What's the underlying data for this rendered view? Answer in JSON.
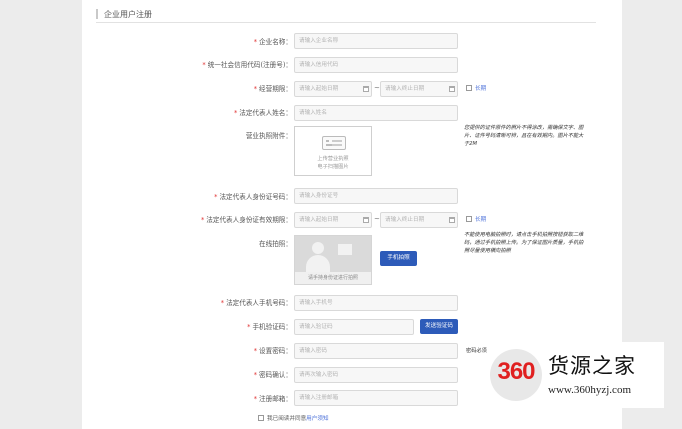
{
  "header": {
    "title": "企业用户注册"
  },
  "fields": {
    "company_name": {
      "label": "企业名称：",
      "placeholder": "请输入企业名称"
    },
    "credit_code": {
      "label": "统一社会信用代码(注册号)：",
      "placeholder": "请输入信用代码"
    },
    "business_period": {
      "label": "经营期限：",
      "start_placeholder": "请输入起始日期",
      "end_placeholder": "请输入终止日期",
      "dash": "~",
      "long_term": "长期"
    },
    "legal_rep_name": {
      "label": "法定代表人姓名：",
      "placeholder": "请输入姓名"
    },
    "license_attachment": {
      "label": "营业执照附件：",
      "upload_line1": "上传营业执照",
      "upload_line2": "电子扫描图片",
      "note_lines": [
        "您提供的证件原件的照片不得涂改，需确保文字、图",
        "片、证件号码清晰可辨，且在有效期内。图片不能大",
        "于2M"
      ]
    },
    "legal_rep_id": {
      "label": "法定代表人身份证号码：",
      "placeholder": "请输入身份证号"
    },
    "legal_rep_id_period": {
      "label": "法定代表人身份证有效期限：",
      "start_placeholder": "请输入起始日期",
      "end_placeholder": "请输入终止日期",
      "dash": "~",
      "long_term": "长期"
    },
    "online_photo": {
      "label": "在线拍照：",
      "caption": "请手持身份证进行拍照",
      "button": "手机拍照",
      "note_lines": [
        "不能使用电脑拍照时，请点击手机拍照按钮获取二维",
        "码，通过手机拍照上传。为了保证图片质量，手机拍",
        "照尽量使用横向拍照"
      ]
    },
    "legal_rep_phone": {
      "label": "法定代表人手机号码：",
      "placeholder": "请输入手机号"
    },
    "sms_code": {
      "label": "手机验证码：",
      "placeholder": "请输入验证码",
      "button": "发送验证码"
    },
    "password": {
      "label": "设置密码：",
      "placeholder": "请输入密码",
      "hint": "密码必须"
    },
    "password_confirm": {
      "label": "密码确认：",
      "placeholder": "请再次输入密码"
    },
    "email": {
      "label": "注册邮箱：",
      "placeholder": "请输入注册邮箱"
    }
  },
  "agreement": {
    "prefix": "我已阅读并同意",
    "link": "用户须知"
  },
  "required_mark": "*",
  "watermark": {
    "number": "360",
    "brand": "货源之家",
    "url": "www.360hyzj.com"
  },
  "colors": {
    "primary_button": "#2d5bb9",
    "required": "#e03131",
    "link": "#4a6fd9",
    "watermark_red": "#e02020"
  }
}
